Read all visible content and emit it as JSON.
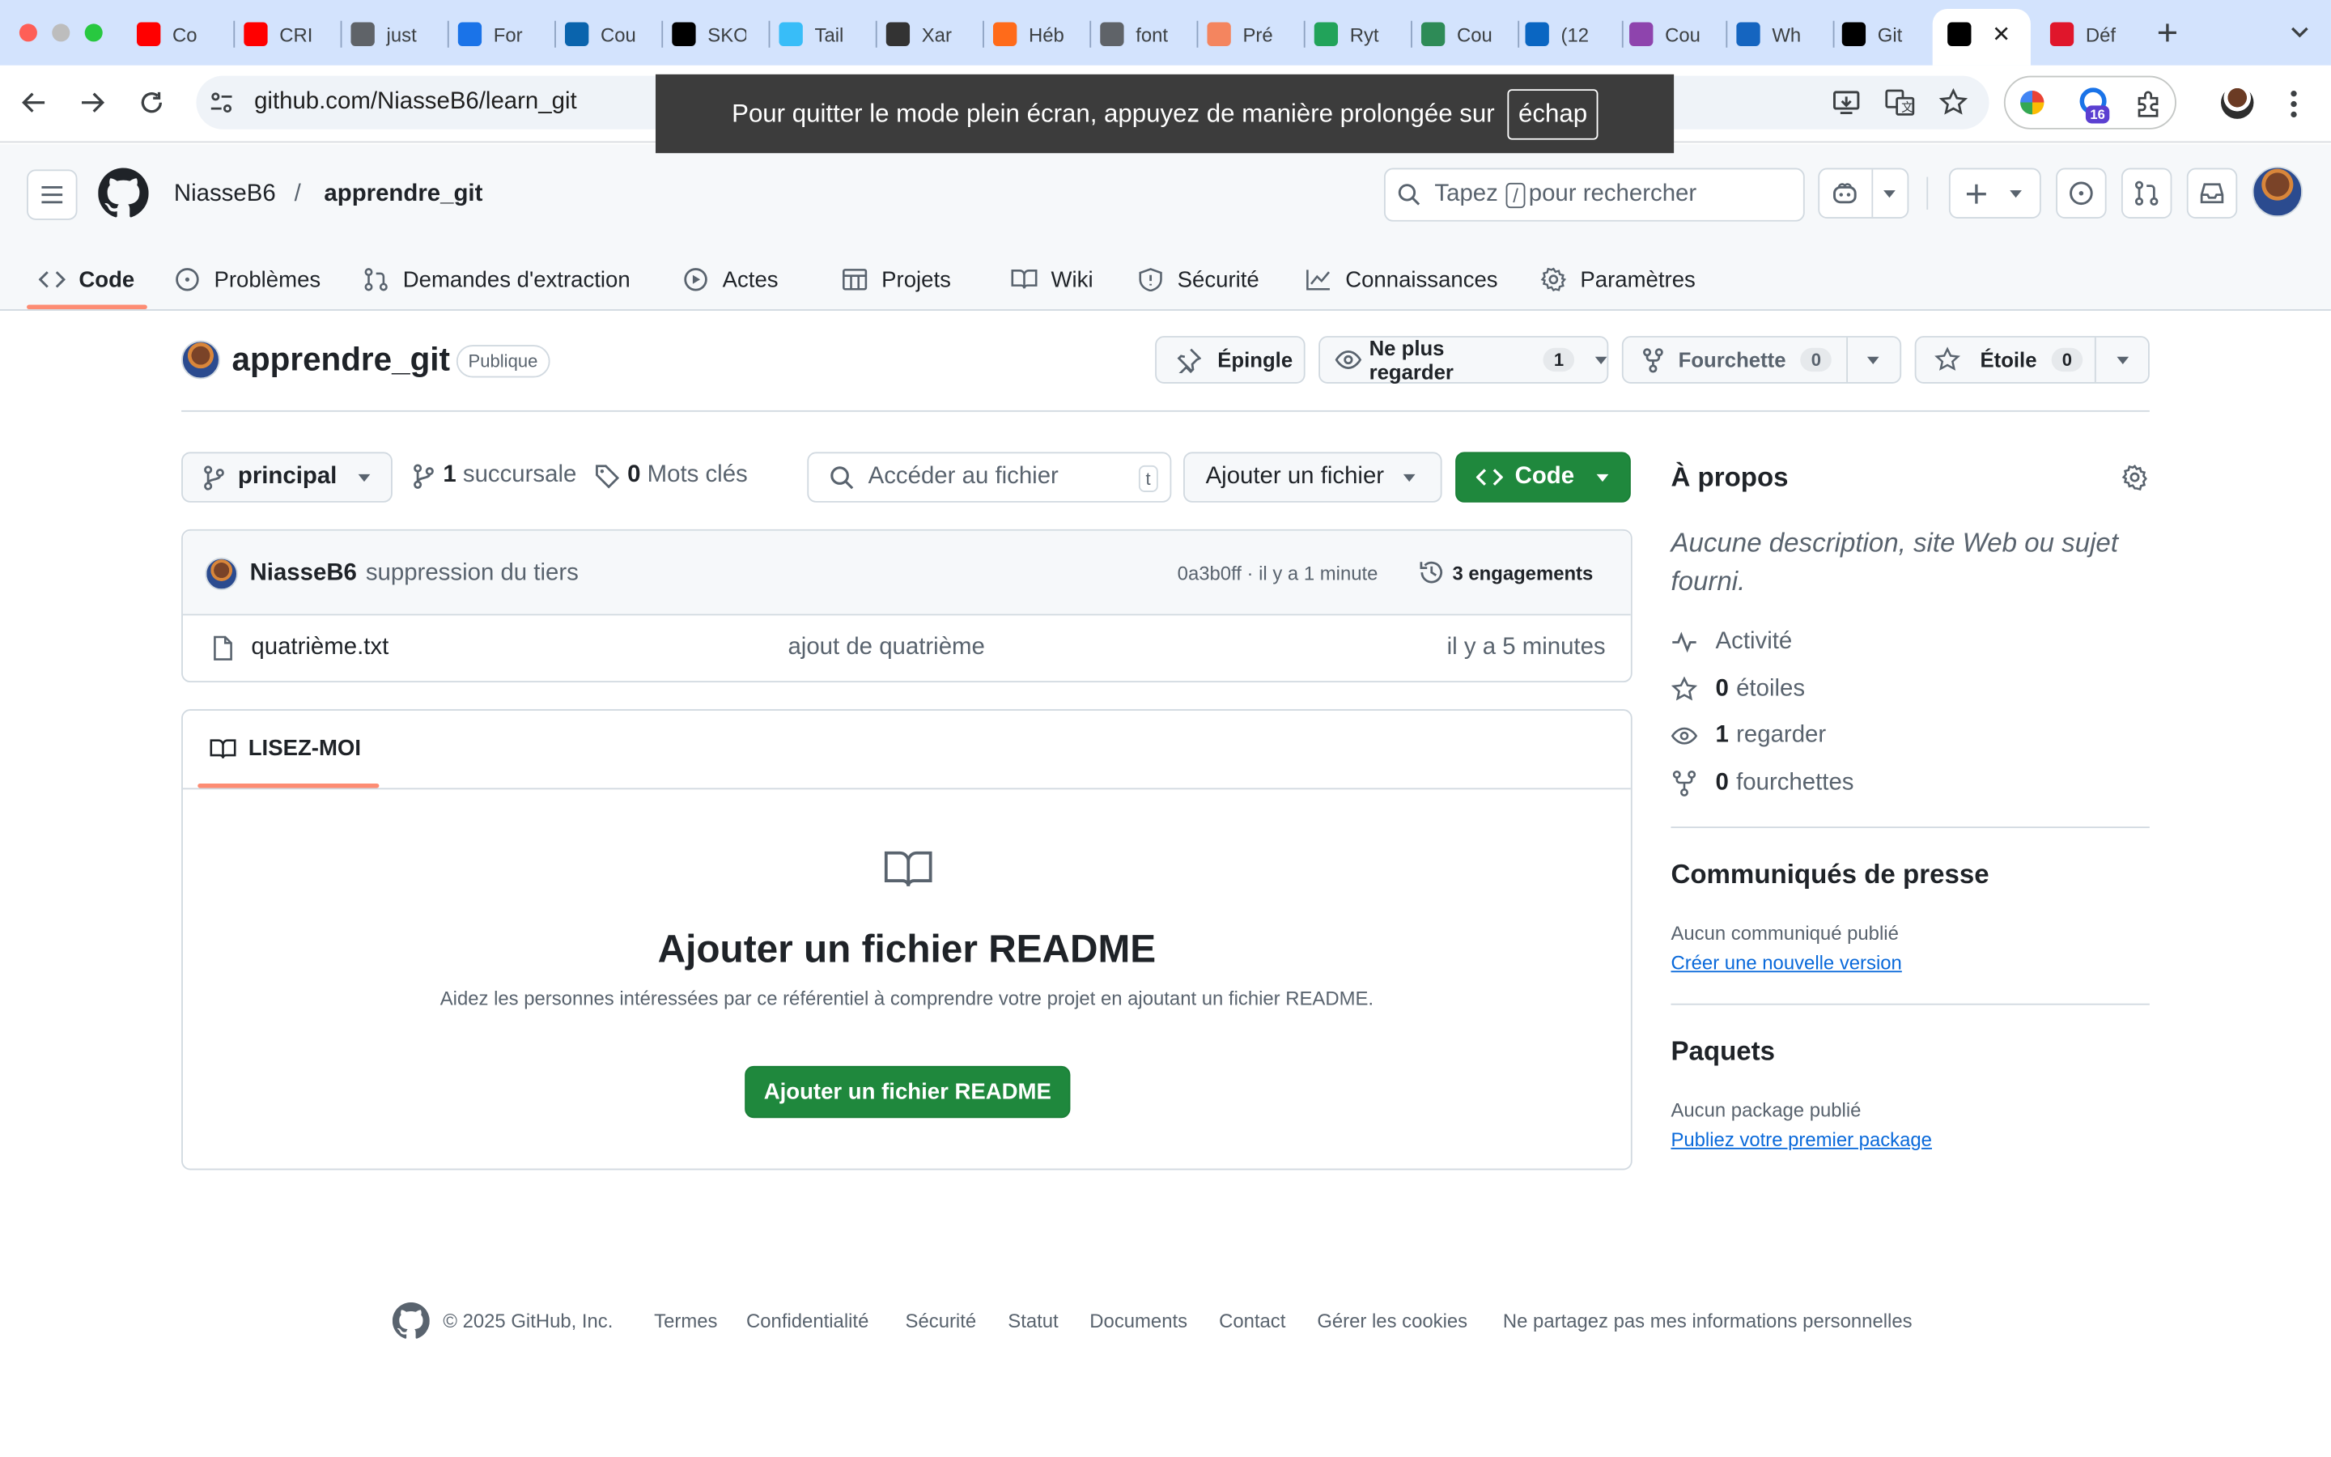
{
  "browser": {
    "tabs": [
      {
        "label": "Co",
        "icon": "youtube-icon",
        "color": "#ff0000"
      },
      {
        "label": "CRI",
        "icon": "youtube-icon",
        "color": "#ff0000"
      },
      {
        "label": "just",
        "icon": "globe-icon",
        "color": "#5f6368"
      },
      {
        "label": "For",
        "icon": "flag-icon",
        "color": "#1a73e8"
      },
      {
        "label": "Cou",
        "icon": "outlook-icon",
        "color": "#0a64ad"
      },
      {
        "label": "SKO",
        "icon": "sko-icon",
        "color": "#000000"
      },
      {
        "label": "Tail",
        "icon": "tailwind-icon",
        "color": "#38bdf8"
      },
      {
        "label": "Xar",
        "icon": "xarala-icon",
        "color": "#333333"
      },
      {
        "label": "Héb",
        "icon": "hostinger-icon",
        "color": "#ff6b1a"
      },
      {
        "label": "font",
        "icon": "globe-icon",
        "color": "#5f6368"
      },
      {
        "label": "Pré",
        "icon": "power-icon",
        "color": "#f4855f"
      },
      {
        "label": "Ryt",
        "icon": "vue-icon",
        "color": "#22a35a"
      },
      {
        "label": "Cou",
        "icon": "notion-like-icon",
        "color": "#2e8b57"
      },
      {
        "label": "(12",
        "icon": "linkedin-icon",
        "color": "#0a66c2"
      },
      {
        "label": "Cou",
        "icon": "dribbble-icon",
        "color": "#8e44ad"
      },
      {
        "label": "Wh",
        "icon": "puzzle-icon",
        "color": "#1565c0"
      },
      {
        "label": "Git",
        "icon": "notion-icon",
        "color": "#000000"
      },
      {
        "label": "",
        "icon": "github-icon",
        "color": "#000000"
      },
      {
        "label": "Déf",
        "icon": "opera-icon",
        "color": "#e0162b"
      }
    ],
    "url": "github.com/NiasseB6/learn_git",
    "extension_badge": "16",
    "fullscreen_toast": "Pour quitter le mode plein écran, appuyez de manière prolongée sur",
    "fullscreen_key": "échap"
  },
  "header": {
    "owner": "NiasseB6",
    "separator": "/",
    "repo": "apprendre_git",
    "search_prefix": "Tapez",
    "search_key": "/",
    "search_suffix": "pour rechercher"
  },
  "repo_nav": [
    {
      "label": "Code",
      "icon": "code-icon"
    },
    {
      "label": "Problèmes",
      "icon": "issue-icon"
    },
    {
      "label": "Demandes d'extraction",
      "icon": "pull-request-icon"
    },
    {
      "label": "Actes",
      "icon": "play-icon"
    },
    {
      "label": "Projets",
      "icon": "table-icon"
    },
    {
      "label": "Wiki",
      "icon": "book-icon"
    },
    {
      "label": "Sécurité",
      "icon": "shield-icon"
    },
    {
      "label": "Connaissances",
      "icon": "graph-icon"
    },
    {
      "label": "Paramètres",
      "icon": "gear-icon"
    }
  ],
  "repo": {
    "name": "apprendre_git",
    "visibility": "Publique",
    "pin_label": "Épingle",
    "watch_label": "Ne plus regarder",
    "watch_count": "1",
    "fork_label": "Fourchette",
    "fork_count": "0",
    "star_label": "Étoile",
    "star_count": "0"
  },
  "toolbar": {
    "branch": "principal",
    "branches_count": "1",
    "branches_label": "succursale",
    "tags_count": "0",
    "tags_label": "Mots clés",
    "file_search_placeholder": "Accéder au fichier",
    "file_search_key": "t",
    "add_file_label": "Ajouter un fichier",
    "code_label": "Code"
  },
  "last_commit": {
    "author": "NiasseB6",
    "message": "suppression du tiers",
    "hash_time": "0a3b0ff · il y a 1 minute",
    "commits_label": "3 engagements"
  },
  "files": [
    {
      "name": "quatrième.txt",
      "message": "ajout de quatrième",
      "time": "il y a 5 minutes"
    }
  ],
  "readme": {
    "tab_label": "LISEZ-MOI",
    "title": "Ajouter un fichier README",
    "description": "Aidez les personnes intéressées par ce référentiel à comprendre votre projet en ajoutant un fichier README.",
    "button_label": "Ajouter un fichier README"
  },
  "about": {
    "title": "À propos",
    "description": "Aucune description, site Web ou sujet fourni.",
    "stats": [
      {
        "icon": "pulse-icon",
        "strong": "",
        "label": "Activité"
      },
      {
        "icon": "star-icon",
        "strong": "0",
        "label": "étoiles"
      },
      {
        "icon": "eye-icon",
        "strong": "1",
        "label": "regarder"
      },
      {
        "icon": "fork-icon",
        "strong": "0",
        "label": "fourchettes"
      }
    ]
  },
  "releases": {
    "title": "Communiqués de presse",
    "empty": "Aucun communiqué publié",
    "link": "Créer une nouvelle version"
  },
  "packages": {
    "title": "Paquets",
    "empty": "Aucun package publié",
    "link": "Publiez votre premier package"
  },
  "footer": {
    "copyright": "© 2025 GitHub, Inc.",
    "links": [
      "Termes",
      "Confidentialité",
      "Sécurité",
      "Statut",
      "Documents",
      "Contact",
      "Gérer les cookies",
      "Ne partagez pas mes informations personnelles"
    ]
  }
}
